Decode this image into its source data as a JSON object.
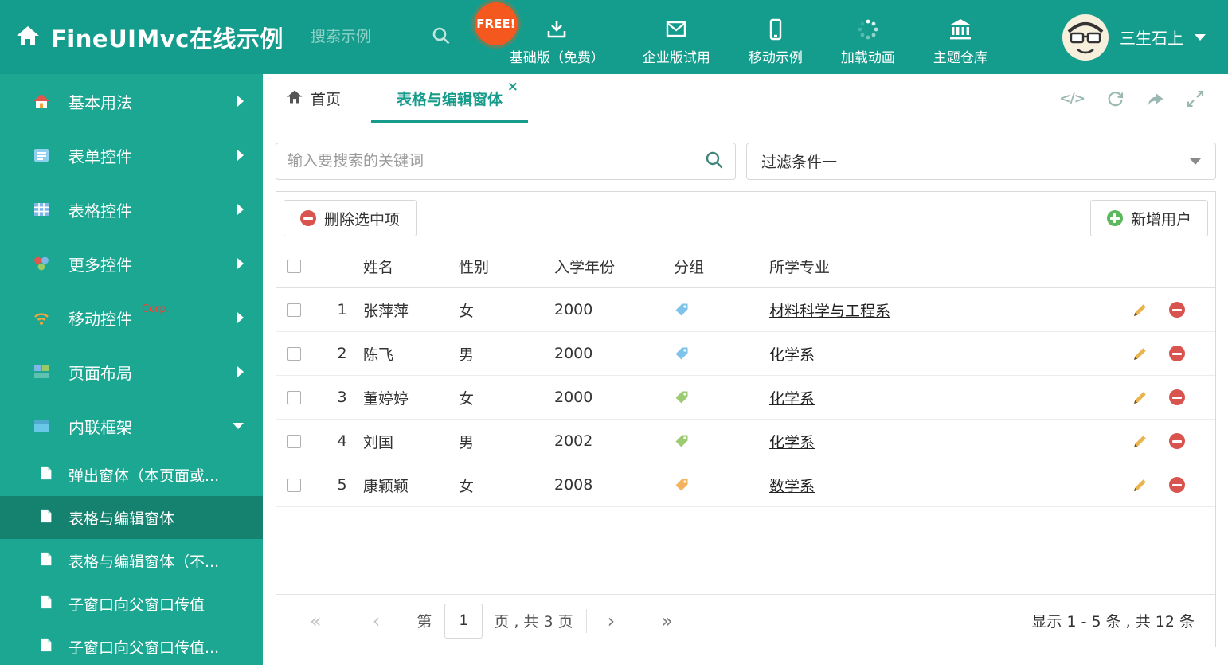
{
  "app": {
    "title": "FineUIMvc在线示例"
  },
  "header": {
    "search_placeholder": "搜索示例",
    "free_badge": "FREE!",
    "nav": [
      {
        "label": "基础版（免费）"
      },
      {
        "label": "企业版试用"
      },
      {
        "label": "移动示例"
      },
      {
        "label": "加载动画"
      },
      {
        "label": "主题仓库"
      }
    ],
    "username": "三生石上"
  },
  "sidebar": {
    "items": [
      {
        "label": "基本用法"
      },
      {
        "label": "表单控件"
      },
      {
        "label": "表格控件"
      },
      {
        "label": "更多控件"
      },
      {
        "label": "移动控件",
        "badge": "Corp."
      },
      {
        "label": "页面布局"
      },
      {
        "label": "内联框架"
      }
    ],
    "subitems": [
      {
        "label": "弹出窗体（本页面或..."
      },
      {
        "label": "表格与编辑窗体"
      },
      {
        "label": "表格与编辑窗体（不..."
      },
      {
        "label": "子窗口向父窗口传值"
      },
      {
        "label": "子窗口向父窗口传值..."
      }
    ]
  },
  "tabs": {
    "home_label": "首页",
    "active_label": "表格与编辑窗体"
  },
  "filter": {
    "search_placeholder": "输入要搜索的关键词",
    "dropdown_value": "过滤条件一"
  },
  "toolbar": {
    "delete_label": "删除选中项",
    "add_label": "新增用户"
  },
  "table": {
    "headers": {
      "name": "姓名",
      "gender": "性别",
      "year": "入学年份",
      "group": "分组",
      "major": "所学专业"
    },
    "rows": [
      {
        "index": "1",
        "name": "张萍萍",
        "gender": "女",
        "year": "2000",
        "tag_color": "#7EC3EA",
        "major": "材料科学与工程系"
      },
      {
        "index": "2",
        "name": "陈飞",
        "gender": "男",
        "year": "2000",
        "tag_color": "#7EC3EA",
        "major": "化学系"
      },
      {
        "index": "3",
        "name": "董婷婷",
        "gender": "女",
        "year": "2000",
        "tag_color": "#9CCB72",
        "major": "化学系"
      },
      {
        "index": "4",
        "name": "刘国",
        "gender": "男",
        "year": "2002",
        "tag_color": "#9CCB72",
        "major": "化学系"
      },
      {
        "index": "5",
        "name": "康颖颖",
        "gender": "女",
        "year": "2008",
        "tag_color": "#F3B25D",
        "major": "数学系"
      }
    ]
  },
  "pagination": {
    "label_page": "第",
    "current_page": "1",
    "label_total": "页 , 共 3 页",
    "summary": "显示 1 - 5 条 , 共 12 条"
  },
  "icons": {
    "pager_first": "«",
    "pager_prev": "‹",
    "pager_next": "›",
    "pager_last": "»",
    "tab_close": "×",
    "code": "</>"
  },
  "colors": {
    "accent": "#179C8B",
    "header_bg": "#149C8C",
    "sidebar_bg": "#1BA791",
    "sidebar_active": "#15826F",
    "free_badge": "#F4581E",
    "delete_red": "#D9534F",
    "add_green": "#5CB85C"
  }
}
